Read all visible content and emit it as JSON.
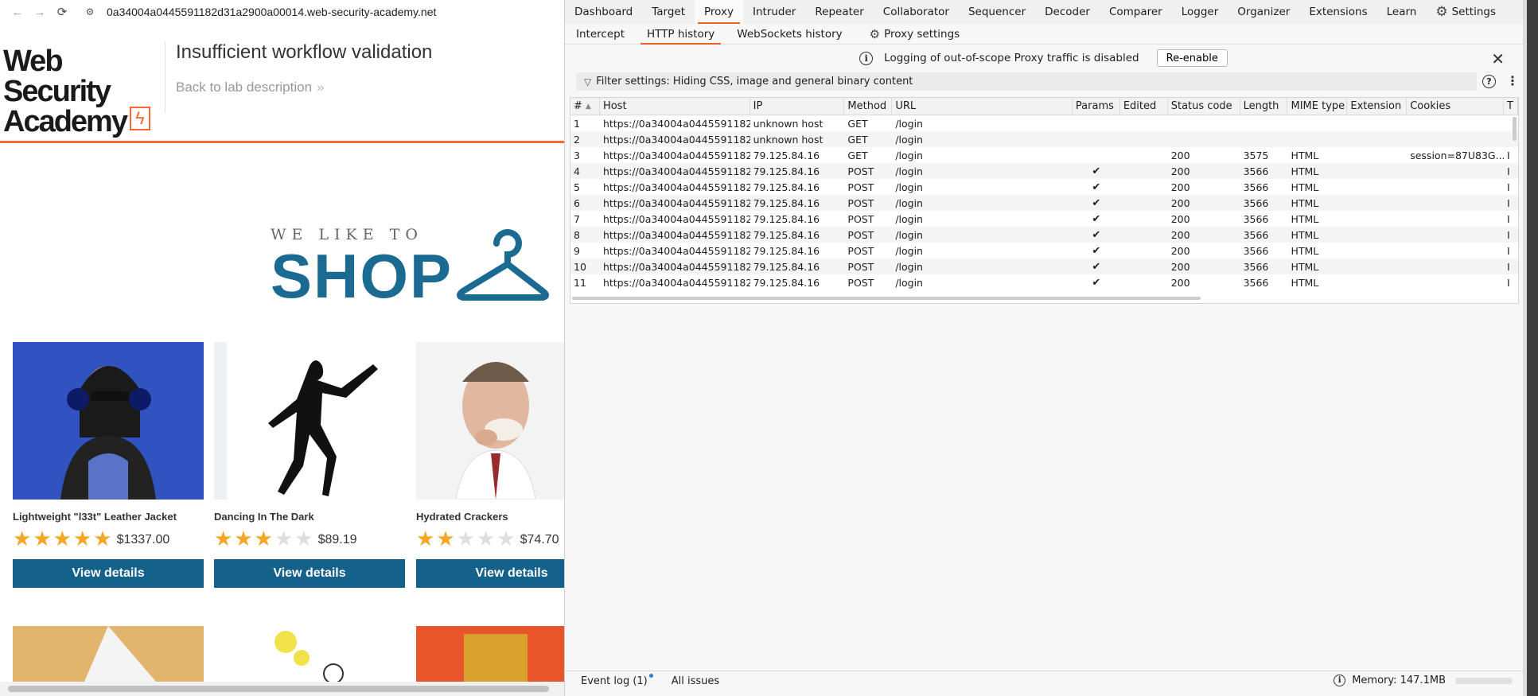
{
  "browser": {
    "url": "0a34004a0445591182d31a2900a00014.web-security-academy.net",
    "nav": {
      "back": "←",
      "forward": "→",
      "reload": "⟳",
      "site_info": "⚙"
    }
  },
  "lab": {
    "logo_line1": "Web Security",
    "logo_line2": "Academy",
    "title": "Insufficient workflow validation",
    "back_link": "Back to lab description",
    "back_chevron": "»"
  },
  "banner": {
    "small": "WE LIKE TO",
    "big": "SHOP"
  },
  "products": [
    {
      "name": "Lightweight \"l33t\" Leather Jacket",
      "rating": 5,
      "price": "$1337.00",
      "button": "View details"
    },
    {
      "name": "Dancing In The Dark",
      "rating": 3,
      "price": "$89.19",
      "button": "View details"
    },
    {
      "name": "Hydrated Crackers",
      "rating": 2,
      "price": "$74.70",
      "button": "View details"
    }
  ],
  "burp": {
    "main_tabs": [
      "Dashboard",
      "Target",
      "Proxy",
      "Intruder",
      "Repeater",
      "Collaborator",
      "Sequencer",
      "Decoder",
      "Comparer",
      "Logger",
      "Organizer",
      "Extensions",
      "Learn"
    ],
    "active_main_tab": "Proxy",
    "settings_label": "Settings",
    "sub_tabs": [
      "Intercept",
      "HTTP history",
      "WebSockets history"
    ],
    "active_sub_tab": "HTTP history",
    "proxy_settings_label": "Proxy settings",
    "notice_text": "Logging of out-of-scope Proxy traffic is disabled",
    "reenable_label": "Re-enable",
    "close_glyph": "✕",
    "filter_text": "Filter settings: Hiding CSS, image and general binary content",
    "help_glyph": "?",
    "kebab_glyph": "⋮",
    "columns": [
      "#",
      "Host",
      "IP",
      "Method",
      "URL",
      "Params",
      "Edited",
      "Status code",
      "Length",
      "MIME type",
      "Extension",
      "Cookies",
      "T"
    ],
    "rows": [
      {
        "num": "1",
        "host": "https://0a34004a0445591182...",
        "ip": "unknown host",
        "method": "GET",
        "url": "/login",
        "params": "",
        "edited": "",
        "status": "",
        "length": "",
        "mime": "",
        "ext": "",
        "cookies": "",
        "t": ""
      },
      {
        "num": "2",
        "host": "https://0a34004a0445591182...",
        "ip": "unknown host",
        "method": "GET",
        "url": "/login",
        "params": "",
        "edited": "",
        "status": "",
        "length": "",
        "mime": "",
        "ext": "",
        "cookies": "",
        "t": ""
      },
      {
        "num": "3",
        "host": "https://0a34004a0445591182...",
        "ip": "79.125.84.16",
        "method": "GET",
        "url": "/login",
        "params": "",
        "edited": "",
        "status": "200",
        "length": "3575",
        "mime": "HTML",
        "ext": "",
        "cookies": "session=87U83G...",
        "t": "I"
      },
      {
        "num": "4",
        "host": "https://0a34004a0445591182...",
        "ip": "79.125.84.16",
        "method": "POST",
        "url": "/login",
        "params": "✔",
        "edited": "",
        "status": "200",
        "length": "3566",
        "mime": "HTML",
        "ext": "",
        "cookies": "",
        "t": "I"
      },
      {
        "num": "5",
        "host": "https://0a34004a0445591182...",
        "ip": "79.125.84.16",
        "method": "POST",
        "url": "/login",
        "params": "✔",
        "edited": "",
        "status": "200",
        "length": "3566",
        "mime": "HTML",
        "ext": "",
        "cookies": "",
        "t": "I"
      },
      {
        "num": "6",
        "host": "https://0a34004a0445591182...",
        "ip": "79.125.84.16",
        "method": "POST",
        "url": "/login",
        "params": "✔",
        "edited": "",
        "status": "200",
        "length": "3566",
        "mime": "HTML",
        "ext": "",
        "cookies": "",
        "t": "I"
      },
      {
        "num": "7",
        "host": "https://0a34004a0445591182...",
        "ip": "79.125.84.16",
        "method": "POST",
        "url": "/login",
        "params": "✔",
        "edited": "",
        "status": "200",
        "length": "3566",
        "mime": "HTML",
        "ext": "",
        "cookies": "",
        "t": "I"
      },
      {
        "num": "8",
        "host": "https://0a34004a0445591182...",
        "ip": "79.125.84.16",
        "method": "POST",
        "url": "/login",
        "params": "✔",
        "edited": "",
        "status": "200",
        "length": "3566",
        "mime": "HTML",
        "ext": "",
        "cookies": "",
        "t": "I"
      },
      {
        "num": "9",
        "host": "https://0a34004a0445591182...",
        "ip": "79.125.84.16",
        "method": "POST",
        "url": "/login",
        "params": "✔",
        "edited": "",
        "status": "200",
        "length": "3566",
        "mime": "HTML",
        "ext": "",
        "cookies": "",
        "t": "I"
      },
      {
        "num": "10",
        "host": "https://0a34004a0445591182...",
        "ip": "79.125.84.16",
        "method": "POST",
        "url": "/login",
        "params": "✔",
        "edited": "",
        "status": "200",
        "length": "3566",
        "mime": "HTML",
        "ext": "",
        "cookies": "",
        "t": "I"
      },
      {
        "num": "11",
        "host": "https://0a34004a0445591182...",
        "ip": "79.125.84.16",
        "method": "POST",
        "url": "/login",
        "params": "✔",
        "edited": "",
        "status": "200",
        "length": "3566",
        "mime": "HTML",
        "ext": "",
        "cookies": "",
        "t": "I"
      }
    ],
    "status_bar": {
      "event_log": "Event log (1)",
      "all_issues": "All issues",
      "memory": "Memory: 147.1MB"
    }
  },
  "colors": {
    "accent_orange": "#e8632b",
    "portswigger_orange": "#ff6633",
    "button_blue": "#14618b",
    "shop_blue": "#1a6a91",
    "star_gold": "#f5a623"
  }
}
